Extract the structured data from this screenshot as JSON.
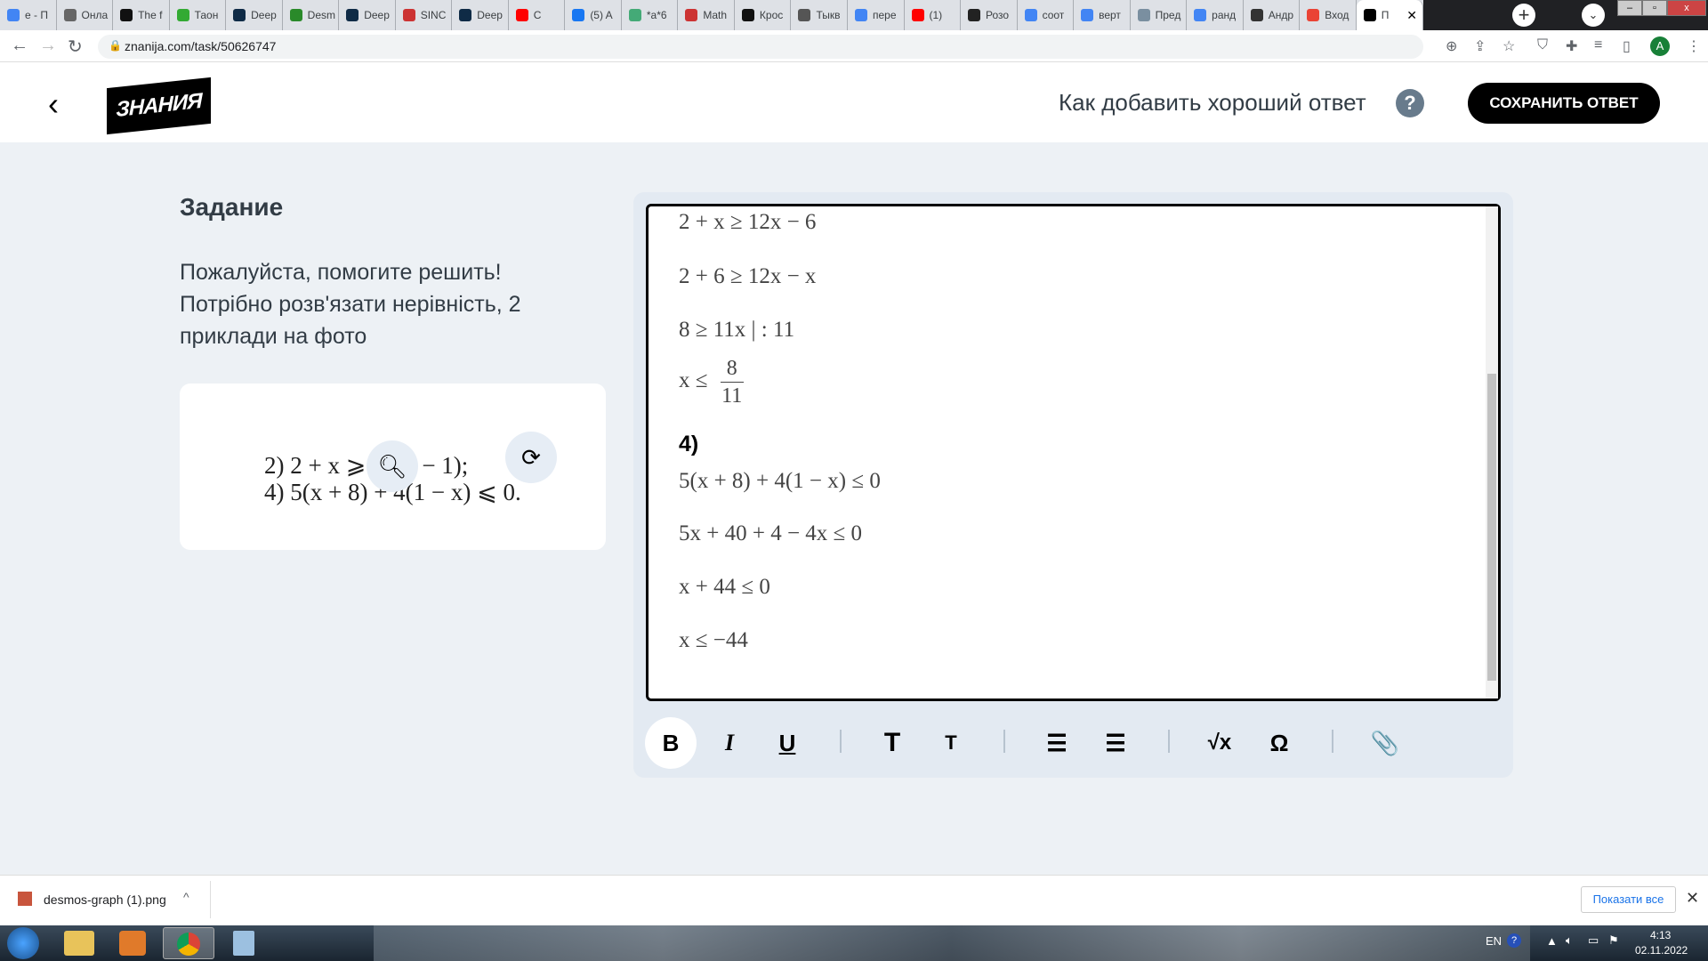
{
  "browser": {
    "tabs": [
      {
        "label": "e - П",
        "color": "#4285f4"
      },
      {
        "label": "Онла",
        "color": "#666"
      },
      {
        "label": "The f",
        "color": "#111"
      },
      {
        "label": "Таон",
        "color": "#3a3"
      },
      {
        "label": "Deep",
        "color": "#0f2b46"
      },
      {
        "label": "Desm",
        "color": "#2a8a2a"
      },
      {
        "label": "Deep",
        "color": "#0f2b46"
      },
      {
        "label": "SINC",
        "color": "#c33"
      },
      {
        "label": "Deep",
        "color": "#0f2b46"
      },
      {
        "label": "C",
        "color": "#f00"
      },
      {
        "label": "(5) A",
        "color": "#1877f2"
      },
      {
        "label": "*a*6",
        "color": "#4a7"
      },
      {
        "label": "Math",
        "color": "#c33"
      },
      {
        "label": "Крос",
        "color": "#111"
      },
      {
        "label": "Тыкв",
        "color": "#555"
      },
      {
        "label": "пере",
        "color": "#4285f4"
      },
      {
        "label": "(1)",
        "color": "#f00"
      },
      {
        "label": "Розо",
        "color": "#222"
      },
      {
        "label": "соот",
        "color": "#4285f4"
      },
      {
        "label": "верт",
        "color": "#4285f4"
      },
      {
        "label": "Пред",
        "color": "#7a8fa0"
      },
      {
        "label": "ранд",
        "color": "#4285f4"
      },
      {
        "label": "Андр",
        "color": "#333"
      },
      {
        "label": "Вход",
        "color": "#ea4335"
      }
    ],
    "active_tab": {
      "label": "П",
      "color": "#000"
    },
    "url": "znanija.com/task/50626747",
    "profile_initial": "A"
  },
  "header": {
    "logo": "ЗНАНИЯ",
    "howto": "Как добавить хороший ответ",
    "help": "?",
    "save_label": "СОХРАНИТЬ ОТВЕТ"
  },
  "task": {
    "title": "Задание",
    "text": "Пожалуйста, помогите решить! Потрібно розв'язати нерівність, 2 приклади на фото",
    "image_lines": [
      "2) 2 + x ⩾ 3(4x − 1);",
      "4) 5(x + 8) + 4(1 − x) ⩽ 0."
    ]
  },
  "editor": {
    "lines": [
      "2 + x ≥ 12x − 6",
      "2 + 6 ≥ 12x − x",
      "8 ≥ 11x | : 11",
      "x ≤",
      "4)",
      "5(x + 8) + 4(1 − x) ≤ 0",
      "5x + 40 + 4 − 4x ≤ 0",
      "x + 44 ≤ 0",
      "x ≤ −44"
    ],
    "fraction": {
      "numerator": "8",
      "denominator": "11"
    },
    "scroll_position_percent": 100
  },
  "toolbar": {
    "bold": "B",
    "italic": "I",
    "underline": "U",
    "heading": "T",
    "subheading": "T",
    "ordered_list": "☰",
    "bullet_list": "☰",
    "formula": "√x",
    "symbol": "Ω",
    "attach": "📎"
  },
  "download": {
    "filename": "desmos-graph (1).png",
    "show_all": "Показати все"
  },
  "taskbar": {
    "lang": "EN",
    "time": "4:13",
    "date": "02.11.2022"
  }
}
